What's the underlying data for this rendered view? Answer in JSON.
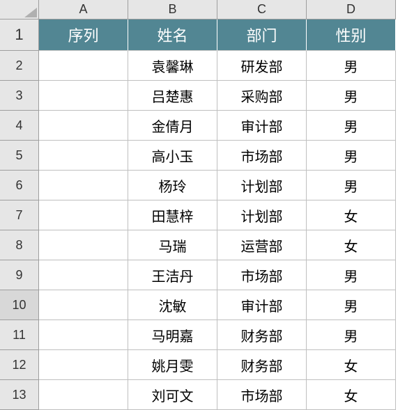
{
  "colHeaders": [
    "A",
    "B",
    "C",
    "D"
  ],
  "rowHeaders": [
    "1",
    "2",
    "3",
    "4",
    "5",
    "6",
    "7",
    "8",
    "9",
    "10",
    "11",
    "12",
    "13"
  ],
  "selectedRow": "10",
  "headerRow": {
    "A": "序列",
    "B": "姓名",
    "C": "部门",
    "D": "性别"
  },
  "chart_data": {
    "type": "table",
    "columns": [
      "序列",
      "姓名",
      "部门",
      "性别"
    ],
    "rows": [
      {
        "序列": "",
        "姓名": "袁馨琳",
        "部门": "研发部",
        "性别": "男"
      },
      {
        "序列": "",
        "姓名": "吕楚惠",
        "部门": "采购部",
        "性别": "男"
      },
      {
        "序列": "",
        "姓名": "金倩月",
        "部门": "审计部",
        "性别": "男"
      },
      {
        "序列": "",
        "姓名": "高小玉",
        "部门": "市场部",
        "性别": "男"
      },
      {
        "序列": "",
        "姓名": "杨玲",
        "部门": "计划部",
        "性别": "男"
      },
      {
        "序列": "",
        "姓名": "田慧梓",
        "部门": "计划部",
        "性别": "女"
      },
      {
        "序列": "",
        "姓名": "马瑞",
        "部门": "运营部",
        "性别": "女"
      },
      {
        "序列": "",
        "姓名": "王洁丹",
        "部门": "市场部",
        "性别": "男"
      },
      {
        "序列": "",
        "姓名": "沈敏",
        "部门": "审计部",
        "性别": "男"
      },
      {
        "序列": "",
        "姓名": "马明嘉",
        "部门": "财务部",
        "性别": "男"
      },
      {
        "序列": "",
        "姓名": "姚月雯",
        "部门": "财务部",
        "性别": "女"
      },
      {
        "序列": "",
        "姓名": "刘可文",
        "部门": "市场部",
        "性别": "女"
      }
    ]
  }
}
